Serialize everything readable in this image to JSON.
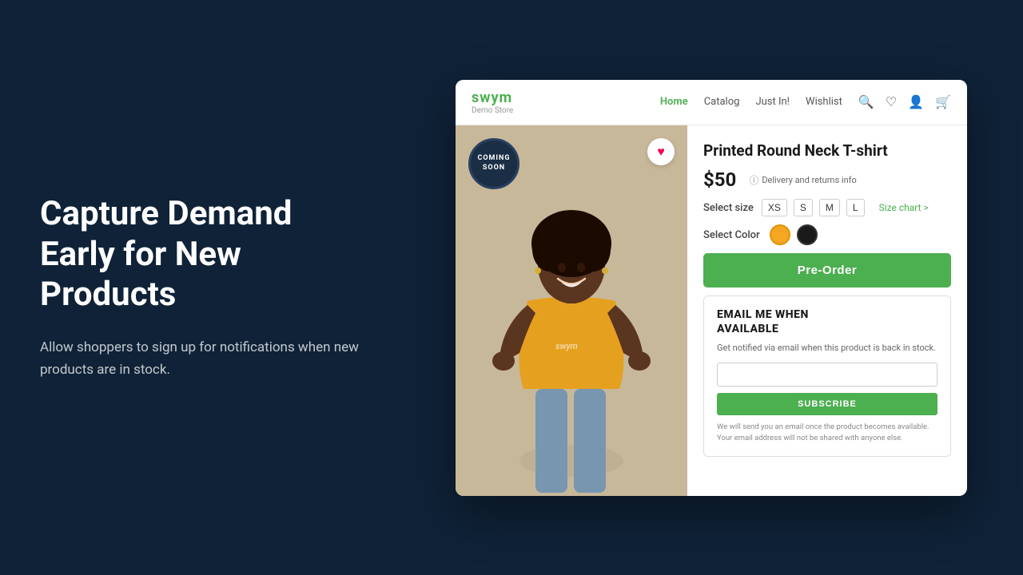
{
  "left": {
    "headline": "Capture Demand Early for New Products",
    "subtext": "Allow shoppers to sign up for notifications when new products are in stock."
  },
  "storefront": {
    "brand": {
      "name": "swym",
      "sub": "Demo Store"
    },
    "nav": {
      "links": [
        {
          "label": "Home",
          "active": true
        },
        {
          "label": "Catalog",
          "active": false
        },
        {
          "label": "Just In!",
          "active": false
        },
        {
          "label": "Wishlist",
          "active": false
        }
      ]
    },
    "product": {
      "badge": "COMING\nSOON",
      "title": "Printed Round Neck T-shirt",
      "price": "$50",
      "delivery": "Delivery and returns info",
      "size_label": "Select size",
      "sizes": [
        "XS",
        "S",
        "M",
        "L"
      ],
      "size_chart": "Size chart >",
      "color_label": "Select Color",
      "preorder_label": "Pre-Order"
    },
    "email_box": {
      "title": "EMAIL ME WHEN\nAVAILABLE",
      "desc": "Get notified via email when this product is back in stock.",
      "input_placeholder": "",
      "subscribe_label": "SUBSCRIBE",
      "disclaimer": "We will send you an email once the product becomes available. Your email address will not be shared with anyone else."
    }
  }
}
